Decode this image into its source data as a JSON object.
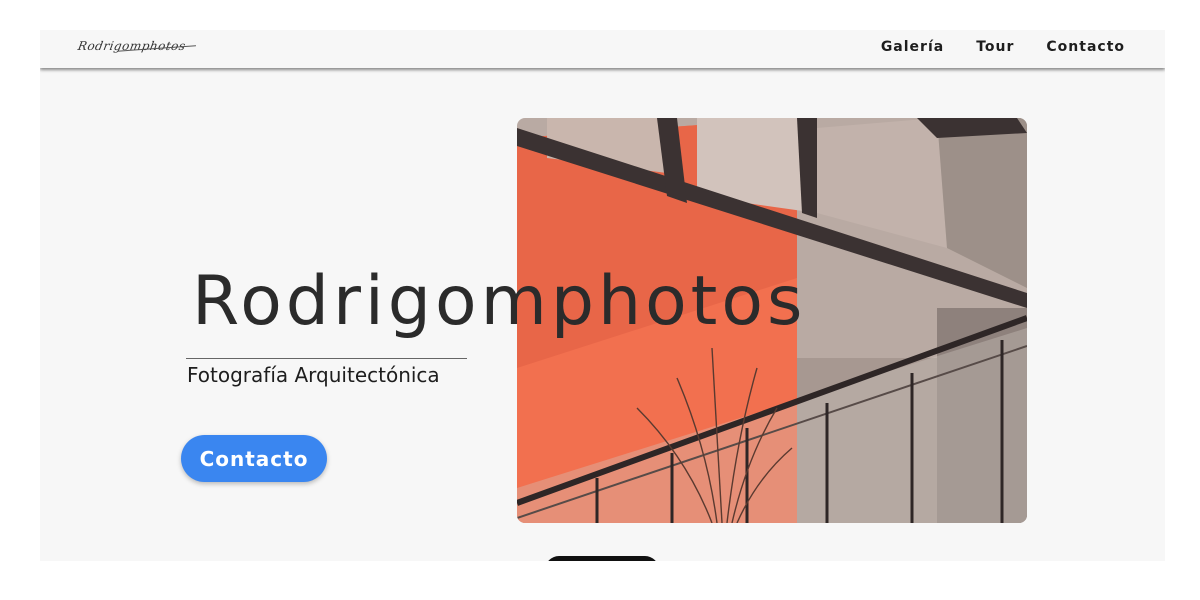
{
  "header": {
    "logo_text": "Rodrigomphotos",
    "nav": [
      {
        "label": "Galería"
      },
      {
        "label": "Tour"
      },
      {
        "label": "Contacto"
      }
    ]
  },
  "hero": {
    "title": "Rodrigomphotos",
    "subtitle": "Fotografía Arquitectónica",
    "cta_label": "Contacto",
    "image_alt": "architecture-photo"
  },
  "colors": {
    "accent": "#3a86f0",
    "orange_wall": "#f2704f",
    "background": "#f7f7f7"
  }
}
